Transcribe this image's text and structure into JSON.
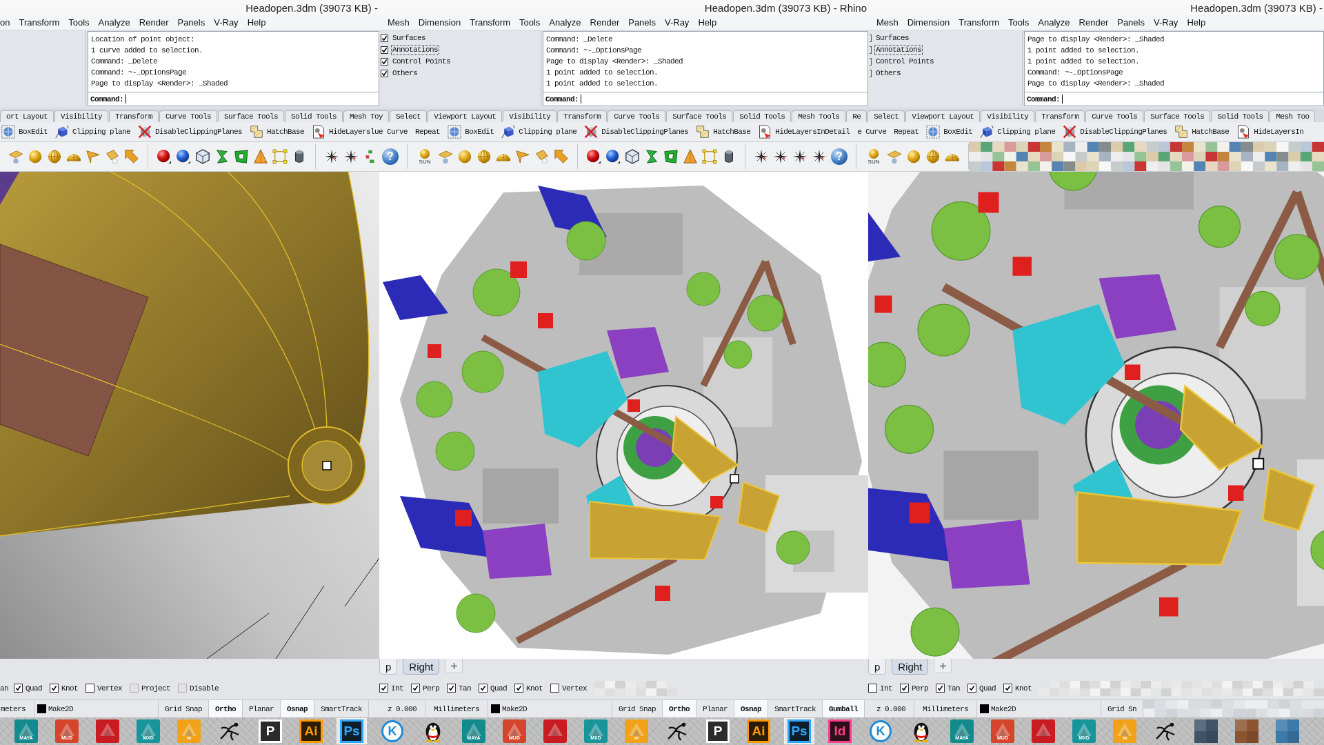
{
  "windows": [
    {
      "title": "Headopen.3dm (39073 KB) -",
      "menu": [
        "on",
        "Transform",
        "Tools",
        "Analyze",
        "Render",
        "Panels",
        "V-Ray",
        "Help"
      ],
      "command_history": [
        "Location of point object:",
        "1 curve added to selection.",
        "Command: _Delete",
        "Command: ~-_OptionsPage",
        "Page to display <Render>: _Shaded"
      ],
      "command_prompt": "Command:",
      "toolbar_tabs": [
        "ort Layout",
        "Visibility",
        "Transform",
        "Curve Tools",
        "Surface Tools",
        "Solid Tools",
        "Mesh Toy"
      ],
      "toolbar_buttons": [
        {
          "label": "BoxEdit",
          "kind": "tool"
        },
        {
          "label": "Clipping plane",
          "kind": "tool"
        },
        {
          "label": "DisableClippingPlanes",
          "kind": "tool"
        },
        {
          "label": "HatchBase",
          "kind": "tool"
        },
        {
          "label": "HideLayerslue Curve",
          "kind": "tool"
        },
        {
          "label": "Repeat",
          "kind": "command"
        }
      ],
      "icon_toolbar": {
        "help_glyph": "?"
      },
      "osnap_cut_label": "an",
      "osnaps": [
        {
          "label": "Quad",
          "checked": true,
          "disabled": false
        },
        {
          "label": "Knot",
          "checked": true,
          "disabled": false
        },
        {
          "label": "Vertex",
          "checked": false,
          "disabled": false
        },
        {
          "label": "Project",
          "checked": false,
          "disabled": true
        },
        {
          "label": "Disable",
          "checked": false,
          "disabled": true
        }
      ],
      "status_bar": [
        {
          "kind": "field",
          "label": "meters"
        },
        {
          "kind": "layer",
          "label": "Make2D"
        },
        {
          "kind": "toggle",
          "label": "Grid Snap",
          "on": false
        },
        {
          "kind": "toggle",
          "label": "Ortho",
          "on": true
        },
        {
          "kind": "toggle",
          "label": "Planar",
          "on": false
        },
        {
          "kind": "toggle",
          "label": "Osnap",
          "on": true
        },
        {
          "kind": "toggle",
          "label": "SmartTrack",
          "on": false
        }
      ]
    },
    {
      "title": "Headopen.3dm (39073 KB) - Rhino",
      "menu": [
        "Mesh",
        "Dimension",
        "Transform",
        "Tools",
        "Analyze",
        "Render",
        "Panels",
        "V-Ray",
        "Help"
      ],
      "layers": [
        {
          "label": "Surfaces",
          "checked": true,
          "selected": false
        },
        {
          "label": "Annotations",
          "checked": true,
          "selected": true
        },
        {
          "label": "Control Points",
          "checked": true,
          "selected": false
        },
        {
          "label": "Others",
          "checked": true,
          "selected": false
        }
      ],
      "command_history": [
        "Command: _Delete",
        "Command: ~-_OptionsPage",
        "Page to display <Render>: _Shaded",
        "1 point added to selection.",
        "1 point added to selection."
      ],
      "command_prompt": "Command:",
      "toolbar_tabs": [
        "Select",
        "Viewport Layout",
        "Visibility",
        "Transform",
        "Curve Tools",
        "Surface Tools",
        "Solid Tools",
        "Mesh Tools",
        "Re"
      ],
      "toolbar_buttons": [
        {
          "label": "BoxEdit",
          "kind": "tool"
        },
        {
          "label": "Clipping plane",
          "kind": "tool"
        },
        {
          "label": "DisableClippingPlanes",
          "kind": "tool"
        },
        {
          "label": "HatchBase",
          "kind": "tool"
        },
        {
          "label": "HideLayersInDetail",
          "kind": "tool"
        },
        {
          "label": "e Curve",
          "kind": "command"
        },
        {
          "label": "Repeat",
          "kind": "command"
        }
      ],
      "icon_toolbar": {
        "sun_caption": "SUN",
        "help_glyph": "?"
      },
      "viewport_tabs": [
        {
          "label": "p",
          "selected": false
        },
        {
          "label": "Right",
          "selected": true
        }
      ],
      "osnaps": [
        {
          "label": "Int",
          "checked": true,
          "disabled": false
        },
        {
          "label": "Perp",
          "checked": true,
          "disabled": false
        },
        {
          "label": "Tan",
          "checked": true,
          "disabled": false
        },
        {
          "label": "Quad",
          "checked": true,
          "disabled": false
        },
        {
          "label": "Knot",
          "checked": true,
          "disabled": false
        },
        {
          "label": "Vertex",
          "checked": false,
          "disabled": false
        }
      ],
      "status_bar": [
        {
          "kind": "field",
          "label": "z 0.000"
        },
        {
          "kind": "field",
          "label": "Millimeters"
        },
        {
          "kind": "layer",
          "label": "Make2D"
        },
        {
          "kind": "toggle",
          "label": "Grid Snap",
          "on": false
        },
        {
          "kind": "toggle",
          "label": "Ortho",
          "on": true
        },
        {
          "kind": "toggle",
          "label": "Planar",
          "on": false
        },
        {
          "kind": "toggle",
          "label": "Osnap",
          "on": true
        },
        {
          "kind": "toggle",
          "label": "SmartTrack",
          "on": false
        },
        {
          "kind": "toggle",
          "label": "Gumball",
          "on": true
        }
      ]
    },
    {
      "title": "Headopen.3dm (39073 KB) -",
      "menu": [
        "Mesh",
        "Dimension",
        "Transform",
        "Tools",
        "Analyze",
        "Render",
        "Panels",
        "V-Ray",
        "Help"
      ],
      "layers": [
        {
          "label": "Surfaces",
          "selected": false
        },
        {
          "label": "Annotations",
          "selected": true
        },
        {
          "label": "Control Points",
          "selected": false
        },
        {
          "label": "Others",
          "selected": false
        }
      ],
      "command_history": [
        "Page to display <Render>: _Shaded",
        "1 point added to selection.",
        "1 point added to selection.",
        "Command: ~-_OptionsPage",
        "Page to display <Render>: _Shaded"
      ],
      "command_prompt": "Command:",
      "toolbar_tabs": [
        "Select",
        "Viewport Layout",
        "Visibility",
        "Transform",
        "Curve Tools",
        "Surface Tools",
        "Solid Tools",
        "Mesh Too"
      ],
      "toolbar_buttons": [
        {
          "label": "BoxEdit",
          "kind": "tool"
        },
        {
          "label": "Clipping plane",
          "kind": "tool"
        },
        {
          "label": "DisableClippingPlanes",
          "kind": "tool"
        },
        {
          "label": "HatchBase",
          "kind": "tool"
        },
        {
          "label": "HideLayersIn",
          "kind": "tool"
        }
      ],
      "icon_toolbar": {
        "sun_caption": "SUN"
      },
      "viewport_tabs": [
        {
          "label": "p",
          "selected": false
        },
        {
          "label": "Right",
          "selected": true
        }
      ],
      "osnaps": [
        {
          "label": "Int",
          "checked": false,
          "disabled": false
        },
        {
          "label": "Perp",
          "checked": true,
          "disabled": false
        },
        {
          "label": "Tan",
          "checked": true,
          "disabled": false
        },
        {
          "label": "Quad",
          "checked": true,
          "disabled": false
        },
        {
          "label": "Knot",
          "checked": true,
          "disabled": false
        }
      ],
      "status_bar": [
        {
          "kind": "field",
          "label": "z 0.000"
        },
        {
          "kind": "field",
          "label": "Millimeters"
        },
        {
          "kind": "layer",
          "label": "Make2D"
        },
        {
          "kind": "toggle",
          "label": "Grid Sn",
          "on": false
        }
      ]
    }
  ],
  "taskbar": {
    "items": [
      {
        "kind": "emblem",
        "label": "MAYA",
        "color": "#138a8c",
        "selected": false
      },
      {
        "kind": "emblem",
        "label": "MUD",
        "color": "#d4452b",
        "selected": false
      },
      {
        "kind": "emblem",
        "color": "#c81b22",
        "selected": false
      },
      {
        "kind": "emblem",
        "label": "MXD",
        "color": "#17959a",
        "selected": false
      },
      {
        "kind": "emblem",
        "label": "m",
        "color": "#f0a318",
        "selected": false
      },
      {
        "kind": "glyph",
        "selected": false
      },
      {
        "kind": "letter",
        "label": "P",
        "color": "#ffffff",
        "selected": false
      },
      {
        "kind": "letter",
        "label": "Ai",
        "color": "#ff9a00",
        "selected": false
      },
      {
        "kind": "letter",
        "label": "Ps",
        "color": "#31a8ff",
        "selected": true
      },
      {
        "kind": "badge",
        "label": "K",
        "color": "#1e8ad6",
        "selected": false
      },
      {
        "kind": "mascot",
        "selected": false
      },
      {
        "kind": "emblem",
        "label": "MAYA",
        "color": "#138a8c",
        "selected": false
      },
      {
        "kind": "emblem",
        "label": "MUD",
        "color": "#d4452b",
        "selected": false
      },
      {
        "kind": "emblem",
        "color": "#c81b22",
        "selected": false
      },
      {
        "kind": "emblem",
        "label": "MXD",
        "color": "#17959a",
        "selected": false
      },
      {
        "kind": "emblem",
        "label": "m",
        "color": "#f0a318",
        "selected": false
      },
      {
        "kind": "glyph",
        "selected": false
      },
      {
        "kind": "letter",
        "label": "P",
        "color": "#ffffff",
        "selected": false
      },
      {
        "kind": "letter",
        "label": "Ai",
        "color": "#ff9a00",
        "selected": false
      },
      {
        "kind": "letter",
        "label": "Ps",
        "color": "#31a8ff",
        "selected": true
      },
      {
        "kind": "letter",
        "label": "Id",
        "color": "#ff3d8b",
        "selected": false
      },
      {
        "kind": "badge",
        "label": "K",
        "color": "#1e8ad6",
        "selected": false
      },
      {
        "kind": "mascot",
        "selected": false
      },
      {
        "kind": "emblem",
        "label": "MAYA",
        "color": "#138a8c",
        "selected": false
      },
      {
        "kind": "emblem",
        "label": "MUD",
        "color": "#d4452b",
        "selected": false
      },
      {
        "kind": "emblem",
        "color": "#c81b22",
        "selected": false
      },
      {
        "kind": "emblem",
        "label": "MXD",
        "color": "#17959a",
        "selected": false
      },
      {
        "kind": "emblem",
        "label": "m",
        "color": "#f0a318",
        "selected": false
      },
      {
        "kind": "glyph",
        "selected": false
      },
      {
        "kind": "hidden",
        "color": "#3f5468",
        "selected": false
      },
      {
        "kind": "hidden",
        "color": "#8c5530",
        "selected": false
      },
      {
        "kind": "hidden",
        "color": "#3d7aa8",
        "selected": false
      }
    ]
  }
}
